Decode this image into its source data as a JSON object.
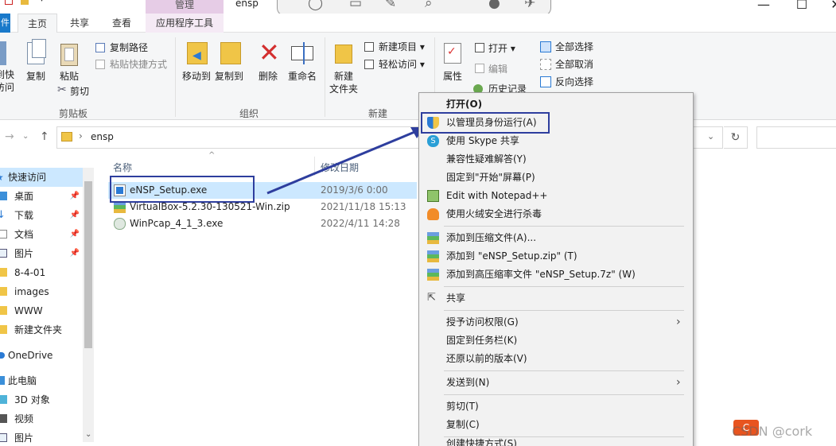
{
  "titlebar": {
    "context_tab": "管理",
    "title": "ensp",
    "minimize": "—",
    "maximize": "☐",
    "close": "✕"
  },
  "tabs": {
    "file": "件",
    "home": "主页",
    "share": "共享",
    "view": "查看",
    "app_tools": "应用程序工具"
  },
  "ribbon": {
    "clipboard": {
      "pin_label_1": "到快",
      "pin_label_2": "访问",
      "copy": "复制",
      "paste": "粘贴",
      "copy_path": "复制路径",
      "paste_shortcut": "粘贴快捷方式",
      "cut": "剪切",
      "group": "剪贴板"
    },
    "organize": {
      "move_to": "移动到",
      "copy_to": "复制到",
      "delete": "删除",
      "rename": "重命名",
      "group": "组织"
    },
    "new": {
      "new_folder_1": "新建",
      "new_folder_2": "文件夹",
      "new_item": "新建项目",
      "easy_access": "轻松访问",
      "group": "新建"
    },
    "open": {
      "properties": "属性",
      "open": "打开",
      "edit": "编辑",
      "history": "历史记录"
    },
    "select": {
      "select_all": "全部选择",
      "select_none": "全部取消",
      "invert": "反向选择"
    }
  },
  "address": {
    "path": "ensp",
    "refresh": "↻"
  },
  "nav": {
    "items": [
      {
        "label": "快速访问",
        "pinned": false
      },
      {
        "label": "桌面",
        "pinned": true
      },
      {
        "label": "下载",
        "pinned": true
      },
      {
        "label": "文档",
        "pinned": true
      },
      {
        "label": "图片",
        "pinned": true
      },
      {
        "label": "8-4-01",
        "pinned": false
      },
      {
        "label": "images",
        "pinned": false
      },
      {
        "label": "WWW",
        "pinned": false
      },
      {
        "label": "新建文件夹",
        "pinned": false
      },
      {
        "label": "OneDrive",
        "pinned": false
      },
      {
        "label": "此电脑",
        "pinned": false
      },
      {
        "label": "3D 对象",
        "pinned": false
      },
      {
        "label": "视频",
        "pinned": false
      },
      {
        "label": "图片",
        "pinned": false
      }
    ]
  },
  "filelist": {
    "col_name": "名称",
    "col_date": "修改日期",
    "files": [
      {
        "name": "eNSP_Setup.exe",
        "date": "2019/3/6 0:00"
      },
      {
        "name": "VirtualBox-5.2.30-130521-Win.zip",
        "date": "2021/11/18 15:13"
      },
      {
        "name": "WinPcap_4_1_3.exe",
        "date": "2022/4/11 14:28"
      }
    ]
  },
  "context_menu": {
    "open": "打开(O)",
    "run_as_admin": "以管理员身份运行(A)",
    "skype_share": "使用 Skype 共享",
    "troubleshoot": "兼容性疑难解答(Y)",
    "pin_start": "固定到\"开始\"屏幕(P)",
    "notepad": "Edit with Notepad++",
    "huorong": "使用火绒安全进行杀毒",
    "add_archive": "添加到压缩文件(A)...",
    "add_zip": "添加到 \"eNSP_Setup.zip\" (T)",
    "add_7z": "添加到高压缩率文件 \"eNSP_Setup.7z\" (W)",
    "share": "共享",
    "grant_access": "授予访问权限(G)",
    "pin_taskbar": "固定到任务栏(K)",
    "restore_prev": "还原以前的版本(V)",
    "send_to": "发送到(N)",
    "cut": "剪切(T)",
    "copy": "复制(C)",
    "create_shortcut": "创建快捷方式(S)"
  },
  "watermark": "CSDN @cork",
  "colors": {
    "accent": "#1979ca",
    "selection": "#cce8ff",
    "highlight_box": "#2e3e9e",
    "context_tab": "#e6cce6"
  }
}
